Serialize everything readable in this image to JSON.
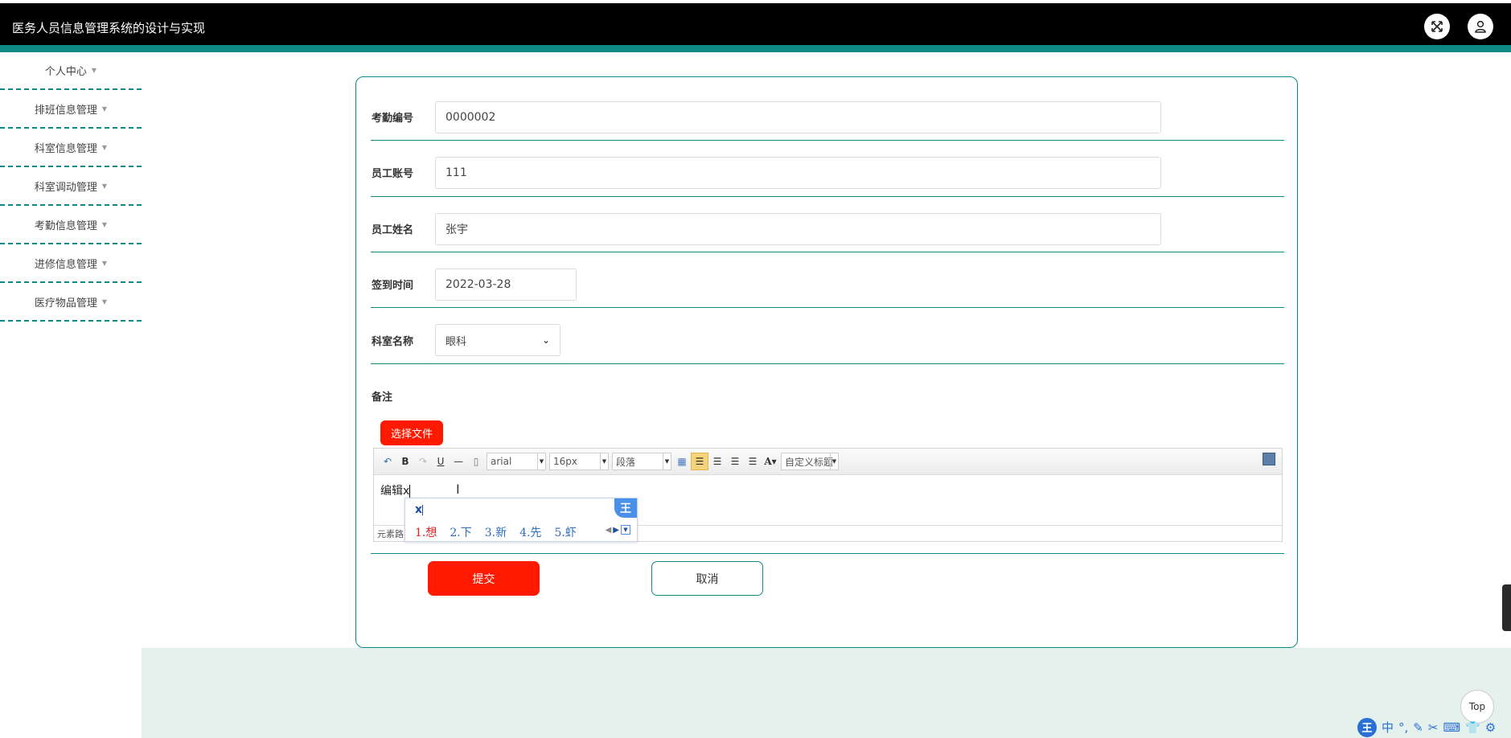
{
  "header": {
    "title": "医务人员信息管理系统的设计与实现",
    "fullscreen_icon": "expand-icon",
    "user_icon": "user-icon"
  },
  "sidebar": {
    "items": [
      {
        "label": "个人中心"
      },
      {
        "label": "排班信息管理"
      },
      {
        "label": "科室信息管理"
      },
      {
        "label": "科室调动管理"
      },
      {
        "label": "考勤信息管理"
      },
      {
        "label": "进修信息管理"
      },
      {
        "label": "医疗物品管理"
      }
    ]
  },
  "form": {
    "fields": [
      {
        "label": "考勤编号",
        "value": "0000002"
      },
      {
        "label": "员工账号",
        "value": "111"
      },
      {
        "label": "员工姓名",
        "value": "张宇"
      },
      {
        "label": "签到时间",
        "value": "2022-03-28"
      },
      {
        "label": "科室名称",
        "value": "眼科"
      }
    ],
    "remark_label": "备注",
    "file_button": "选择文件",
    "submit": "提交",
    "cancel": "取消"
  },
  "editor": {
    "font_family": "arial",
    "font_size": "16px",
    "paragraph": "段落",
    "custom_heading": "自定义标题",
    "content": "编辑x",
    "status_path": "元素路"
  },
  "ime": {
    "input": "x",
    "candidates": [
      "1.想",
      "2.下",
      "3.新",
      "4.先",
      "5.虾"
    ],
    "logo": "王",
    "bar": [
      "中",
      "°,",
      "✎",
      "✂",
      "⌨",
      "👕",
      "⚙"
    ]
  },
  "top_button": "Top",
  "colors": {
    "accent": "#0e8a86",
    "primary_button": "#ff1a00",
    "footer_bg": "#e4f1ed"
  }
}
